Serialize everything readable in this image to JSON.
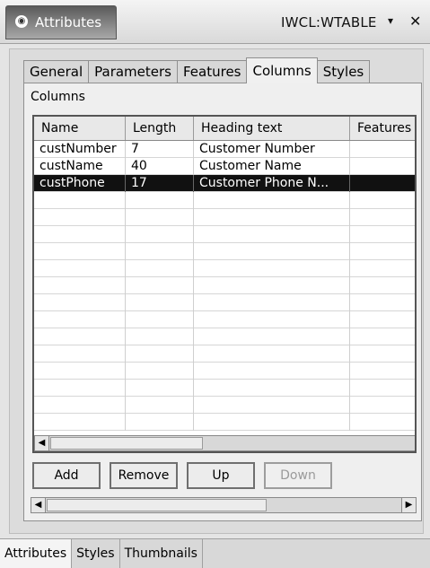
{
  "view": {
    "tab_label": "Attributes",
    "target": "IWCL:WTABLE",
    "menu_glyph": "▾",
    "close_glyph": "✕"
  },
  "tabs": [
    {
      "label": "General",
      "active": false
    },
    {
      "label": "Parameters",
      "active": false
    },
    {
      "label": "Features",
      "active": false
    },
    {
      "label": "Columns",
      "active": true
    },
    {
      "label": "Styles",
      "active": false
    }
  ],
  "section_label": "Columns",
  "table": {
    "headers": [
      "Name",
      "Length",
      "Heading text",
      "Features"
    ],
    "rows": [
      {
        "name": "custNumber",
        "length": "7",
        "heading": "Customer Number",
        "features": "",
        "selected": false
      },
      {
        "name": "custName",
        "length": "40",
        "heading": "Customer Name",
        "features": "",
        "selected": false
      },
      {
        "name": "custPhone",
        "length": "17",
        "heading": "Customer Phone N...",
        "features": "",
        "selected": true
      }
    ],
    "empty_rows": 14
  },
  "buttons": {
    "add": "Add",
    "remove": "Remove",
    "up": "Up",
    "down": "Down"
  },
  "bottom_tabs": [
    {
      "label": "Attributes",
      "active": true
    },
    {
      "label": "Styles",
      "active": false
    },
    {
      "label": "Thumbnails",
      "active": false
    }
  ],
  "icons": {
    "scroll_left": "◀",
    "scroll_right": "▶"
  }
}
